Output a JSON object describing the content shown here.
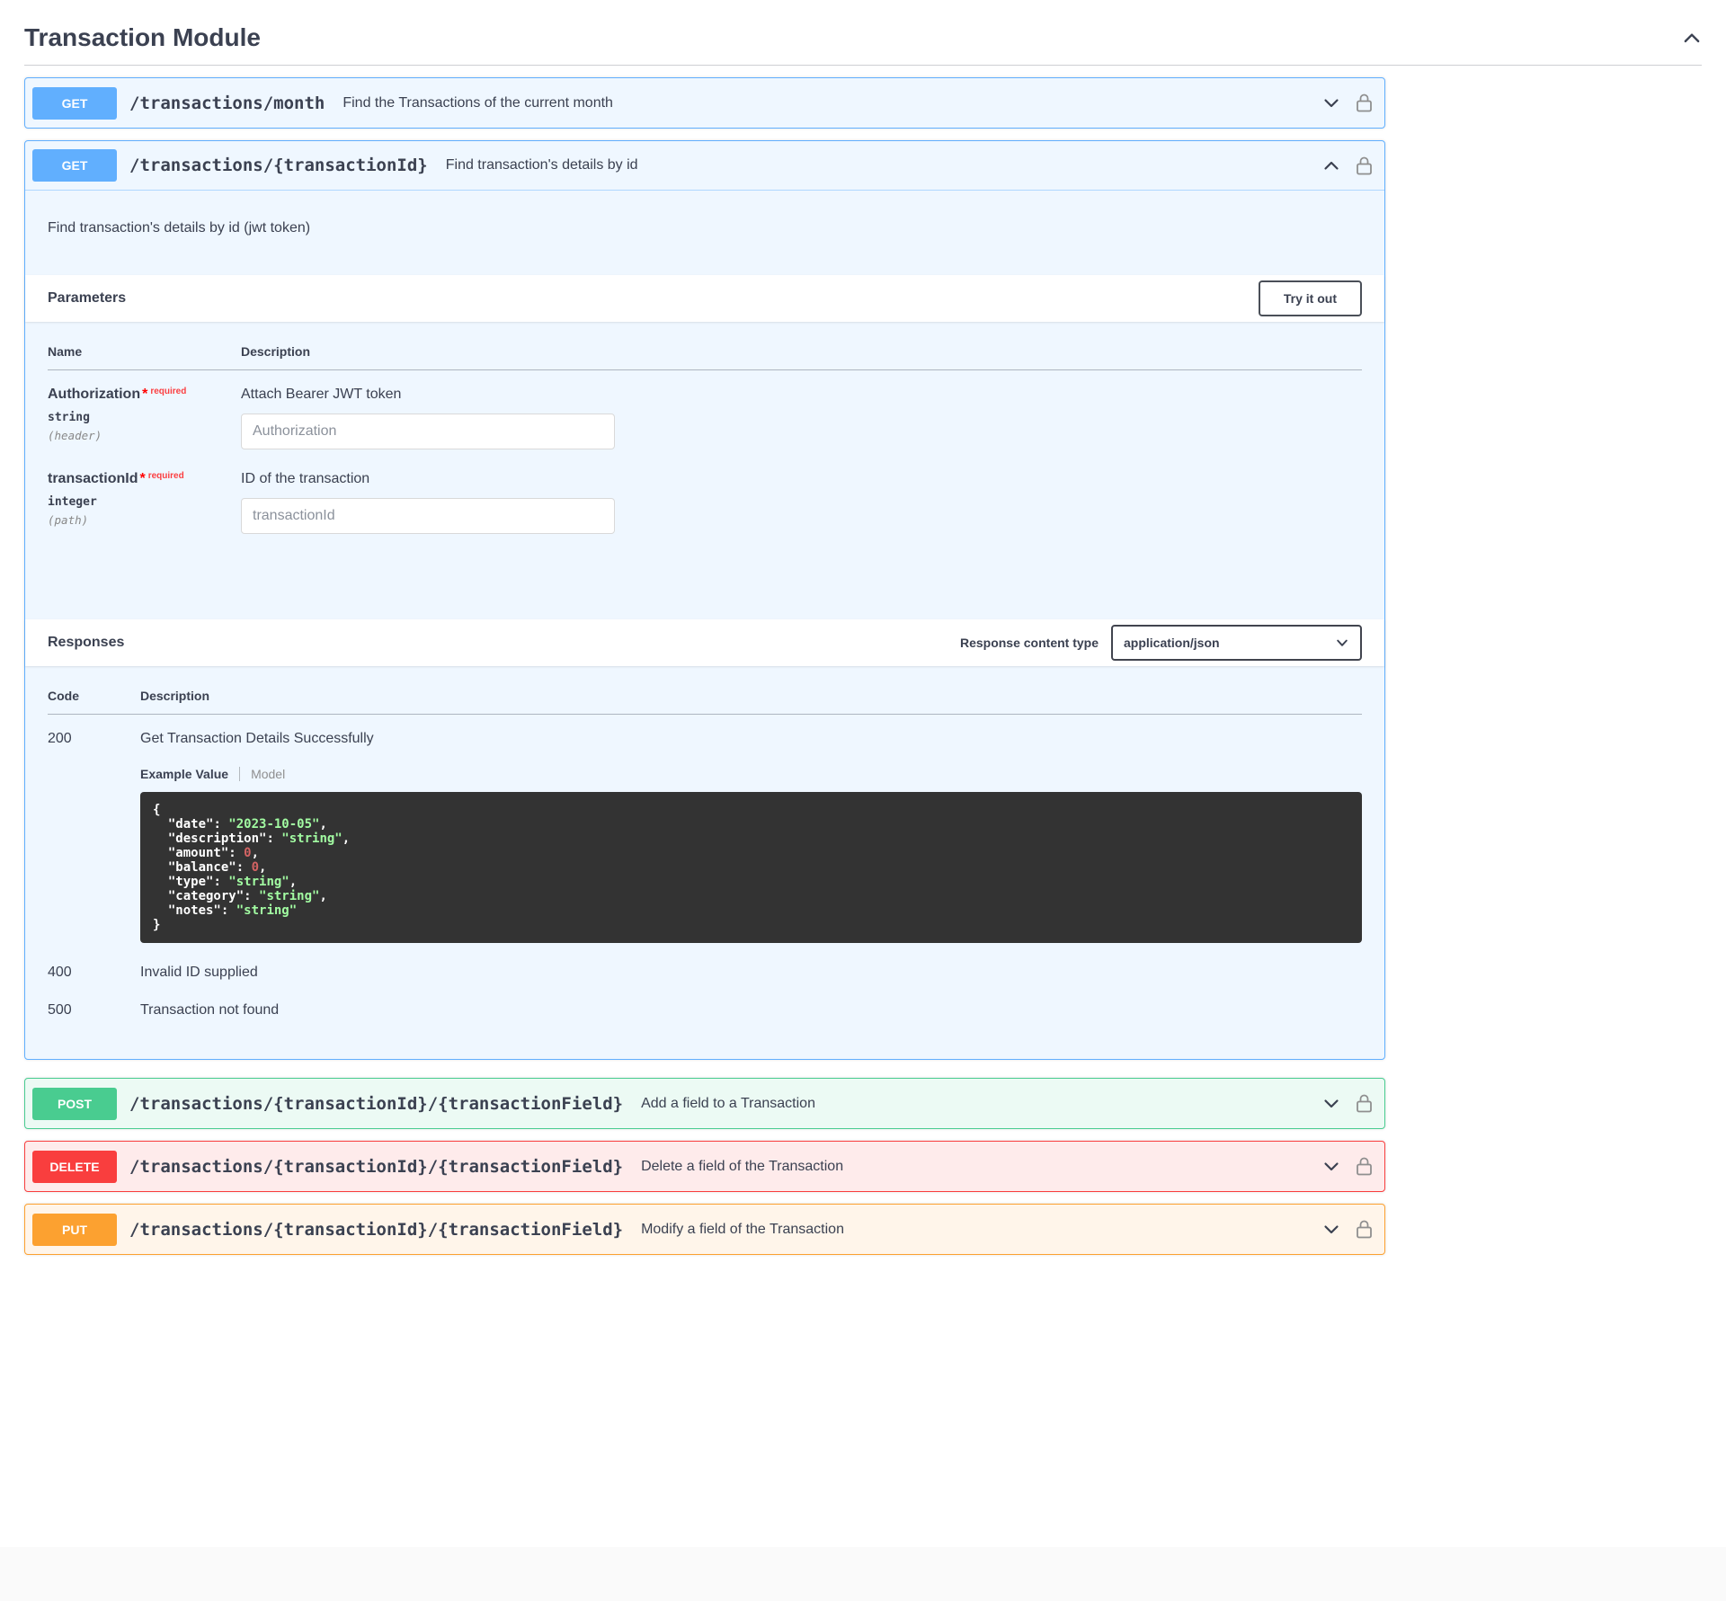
{
  "colors": {
    "get": "#61affe",
    "post": "#49cc90",
    "delete": "#f93e3e",
    "put": "#fca130",
    "text": "#3b4151"
  },
  "header": {
    "title": "Transaction Module"
  },
  "icons": {
    "section_collapse": "chevron-up-icon",
    "expand_operation": "chevron-down-icon",
    "collapse_operation": "chevron-up-icon",
    "authorization": "lock-icon",
    "select_caret": "chevron-down-icon"
  },
  "endpoints": [
    {
      "method": "GET",
      "path": "/transactions/month",
      "summary": "Find the Transactions of the current month"
    },
    {
      "method": "GET",
      "path": "/transactions/{transactionId}",
      "summary": "Find transaction's details by id"
    },
    {
      "method": "POST",
      "path": "/transactions/{transactionId}/{transactionField}",
      "summary": "Add a field to a Transaction"
    },
    {
      "method": "DELETE",
      "path": "/transactions/{transactionId}/{transactionField}",
      "summary": "Delete a field of the Transaction"
    },
    {
      "method": "PUT",
      "path": "/transactions/{transactionId}/{transactionField}",
      "summary": "Modify a field of the Transaction"
    }
  ],
  "expanded": {
    "description": "Find transaction's details by id (jwt token)",
    "parameters": {
      "title": "Parameters",
      "try_it_out_label": "Try it out",
      "columns": {
        "name": "Name",
        "description": "Description"
      },
      "rows": [
        {
          "name": "Authorization",
          "required_marker": "*",
          "required_label": "required",
          "type": "string",
          "location": "(header)",
          "description": "Attach Bearer JWT token",
          "placeholder": "Authorization"
        },
        {
          "name": "transactionId",
          "required_marker": "*",
          "required_label": "required",
          "type": "integer",
          "location": "(path)",
          "description": "ID of the transaction",
          "placeholder": "transactionId"
        }
      ]
    },
    "responses": {
      "title": "Responses",
      "content_type_label": "Response content type",
      "content_type_value": "application/json",
      "columns": {
        "code": "Code",
        "description": "Description"
      },
      "rows": [
        {
          "code": "200",
          "description": "Get Transaction Details Successfully"
        },
        {
          "code": "400",
          "description": "Invalid ID supplied"
        },
        {
          "code": "500",
          "description": "Transaction not found"
        }
      ],
      "example_tabs": {
        "example": "Example Value",
        "model": "Model"
      },
      "example_lines": [
        [
          {
            "c": "p",
            "t": "{"
          }
        ],
        [
          {
            "c": "p",
            "t": "  "
          },
          {
            "c": "k",
            "t": "\"date\""
          },
          {
            "c": "p",
            "t": ": "
          },
          {
            "c": "s",
            "t": "\"2023-10-05\""
          },
          {
            "c": "p",
            "t": ","
          }
        ],
        [
          {
            "c": "p",
            "t": "  "
          },
          {
            "c": "k",
            "t": "\"description\""
          },
          {
            "c": "p",
            "t": ": "
          },
          {
            "c": "s",
            "t": "\"string\""
          },
          {
            "c": "p",
            "t": ","
          }
        ],
        [
          {
            "c": "p",
            "t": "  "
          },
          {
            "c": "k",
            "t": "\"amount\""
          },
          {
            "c": "p",
            "t": ": "
          },
          {
            "c": "n",
            "t": "0"
          },
          {
            "c": "p",
            "t": ","
          }
        ],
        [
          {
            "c": "p",
            "t": "  "
          },
          {
            "c": "k",
            "t": "\"balance\""
          },
          {
            "c": "p",
            "t": ": "
          },
          {
            "c": "n",
            "t": "0"
          },
          {
            "c": "p",
            "t": ","
          }
        ],
        [
          {
            "c": "p",
            "t": "  "
          },
          {
            "c": "k",
            "t": "\"type\""
          },
          {
            "c": "p",
            "t": ": "
          },
          {
            "c": "s",
            "t": "\"string\""
          },
          {
            "c": "p",
            "t": ","
          }
        ],
        [
          {
            "c": "p",
            "t": "  "
          },
          {
            "c": "k",
            "t": "\"category\""
          },
          {
            "c": "p",
            "t": ": "
          },
          {
            "c": "s",
            "t": "\"string\""
          },
          {
            "c": "p",
            "t": ","
          }
        ],
        [
          {
            "c": "p",
            "t": "  "
          },
          {
            "c": "k",
            "t": "\"notes\""
          },
          {
            "c": "p",
            "t": ": "
          },
          {
            "c": "s",
            "t": "\"string\""
          }
        ],
        [
          {
            "c": "p",
            "t": "}"
          }
        ]
      ]
    }
  }
}
